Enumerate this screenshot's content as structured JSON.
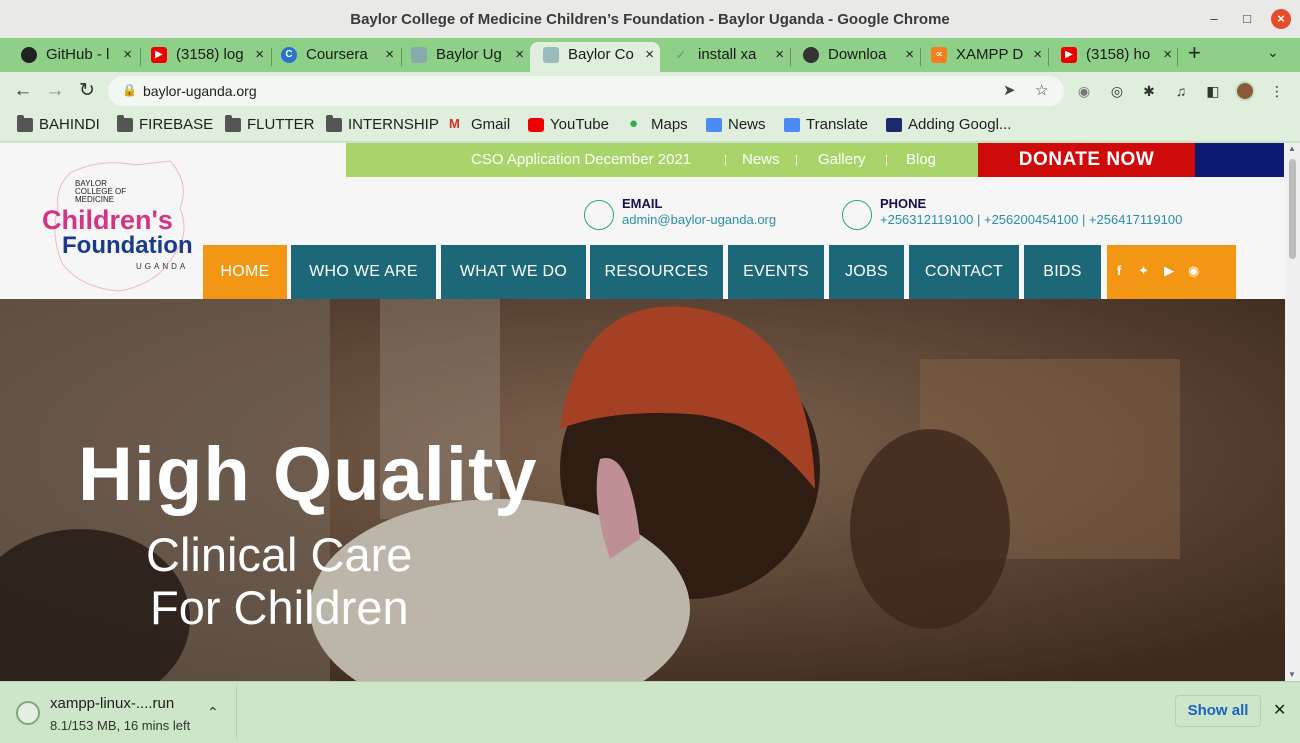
{
  "window": {
    "title": "Baylor College of Medicine Children’s Foundation - Baylor Uganda - Google Chrome"
  },
  "tabs": [
    {
      "label": "GitHub - l",
      "icon": "github-icon",
      "active": false
    },
    {
      "label": "(3158) log",
      "icon": "youtube-icon",
      "active": false
    },
    {
      "label": "Coursera",
      "icon": "coursera-icon",
      "active": false
    },
    {
      "label": "Baylor Ug",
      "icon": "baylor-icon",
      "active": false
    },
    {
      "label": "Baylor Co",
      "icon": "baylor-icon",
      "active": true
    },
    {
      "label": "install xa",
      "icon": "stackoverflow-icon",
      "active": false
    },
    {
      "label": "Downloa",
      "icon": "globe-icon",
      "active": false
    },
    {
      "label": "XAMPP D",
      "icon": "xampp-icon",
      "active": false
    },
    {
      "label": "(3158) ho",
      "icon": "youtube-icon",
      "active": false
    }
  ],
  "toolbar": {
    "url": "baylor-uganda.org"
  },
  "bookmarks": [
    {
      "label": "BAHINDI",
      "icon": "folder-icon"
    },
    {
      "label": "FIREBASE",
      "icon": "folder-icon"
    },
    {
      "label": "FLUTTER",
      "icon": "folder-icon"
    },
    {
      "label": "INTERNSHIP",
      "icon": "folder-icon"
    },
    {
      "label": "Gmail",
      "icon": "gmail-icon"
    },
    {
      "label": "YouTube",
      "icon": "youtube-icon"
    },
    {
      "label": "Maps",
      "icon": "maps-icon"
    },
    {
      "label": "News",
      "icon": "news-icon"
    },
    {
      "label": "Translate",
      "icon": "translate-icon"
    },
    {
      "label": "Adding Googl...",
      "icon": "site-icon"
    }
  ],
  "site": {
    "topbar": {
      "links": [
        "CSO Application December 2021",
        "News",
        "Gallery",
        "Blog"
      ],
      "separator": "|",
      "donate": "DONATE NOW"
    },
    "logo": {
      "line1": "BAYLOR",
      "line2": "COLLEGE OF",
      "line3": "MEDICINE",
      "line4": "Children's",
      "line5": "Foundation",
      "line6": "UGANDA"
    },
    "contact": {
      "email_title": "EMAIL",
      "email_value": "admin@baylor-uganda.org",
      "phone_title": "PHONE",
      "phone_value": "+256312119100 | +256200454100 | +256417119100"
    },
    "nav": [
      "HOME",
      "WHO WE ARE",
      "WHAT WE DO",
      "RESOURCES",
      "EVENTS",
      "JOBS",
      "CONTACT",
      "BIDS"
    ],
    "social_icons": [
      "facebook-icon",
      "twitter-icon",
      "youtube-icon",
      "instagram-icon"
    ],
    "hero": {
      "line1": "High Quality",
      "line2": "Clinical Care",
      "line3": "For Children"
    },
    "colors": {
      "topbar": "#a9d46a",
      "donate": "#cf0a0a",
      "nav": "#1d6878",
      "accent": "#f39614"
    }
  },
  "download": {
    "filename": "xampp-linux-....run",
    "status": "8.1/153 MB, 16 mins left",
    "show_all": "Show all"
  }
}
